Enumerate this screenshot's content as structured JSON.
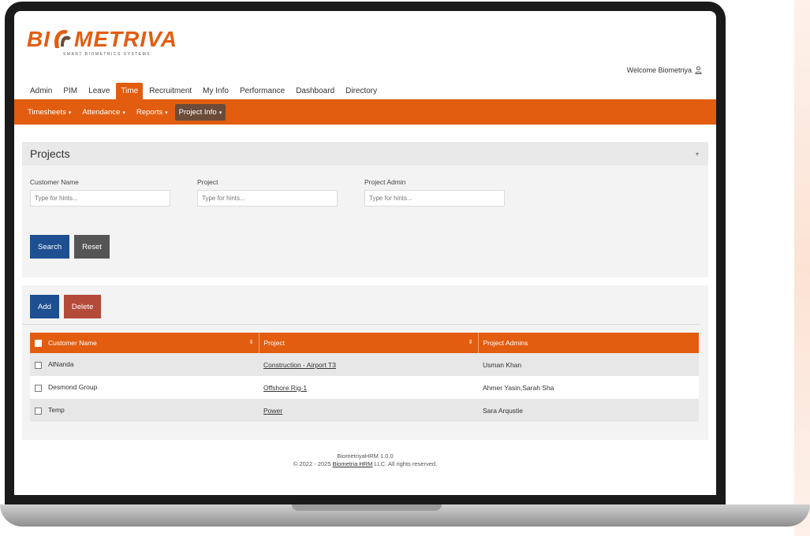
{
  "brand": {
    "logo_left": "BI",
    "logo_right": "METRIVA",
    "tagline": "SMART BIOMETRICS SYSTEMS",
    "accent": "#e25d10"
  },
  "header": {
    "welcome": "Welcome Biometriya"
  },
  "main_nav": [
    "Admin",
    "PIM",
    "Leave",
    "Time",
    "Recruitment",
    "My Info",
    "Performance",
    "Dashboard",
    "Directory"
  ],
  "main_nav_active": "Time",
  "sub_nav": [
    {
      "label": "Timesheets",
      "active": false
    },
    {
      "label": "Attendance",
      "active": false
    },
    {
      "label": "Reports",
      "active": false
    },
    {
      "label": "Project Info",
      "active": true
    }
  ],
  "search_panel": {
    "title": "Projects",
    "fields": [
      {
        "label": "Customer Name",
        "placeholder": "Type for hints..."
      },
      {
        "label": "Project",
        "placeholder": "Type for hints..."
      },
      {
        "label": "Project Admin",
        "placeholder": "Type for hints..."
      }
    ],
    "search_label": "Search",
    "reset_label": "Reset"
  },
  "list_panel": {
    "add_label": "Add",
    "delete_label": "Delete",
    "columns": [
      "Customer Name",
      "Project",
      "Project Admins"
    ],
    "rows": [
      {
        "customer": "AlNanda",
        "project": "Construction - Airport T3",
        "admins": "Usman Khan"
      },
      {
        "customer": "Desmond Group",
        "project": "Offshore Rig-1",
        "admins": "Ahmer Yasin,Sarah Sha"
      },
      {
        "customer": "Temp",
        "project": "Power",
        "admins": "Sara Arqustie"
      }
    ]
  },
  "footer": {
    "version": "BiometriyaHRM 1.0.0",
    "copyright_prefix": "© 2022 - 2025",
    "company_link": "Biometria HRM",
    "copyright_suffix": "LLC. All rights reserved."
  }
}
